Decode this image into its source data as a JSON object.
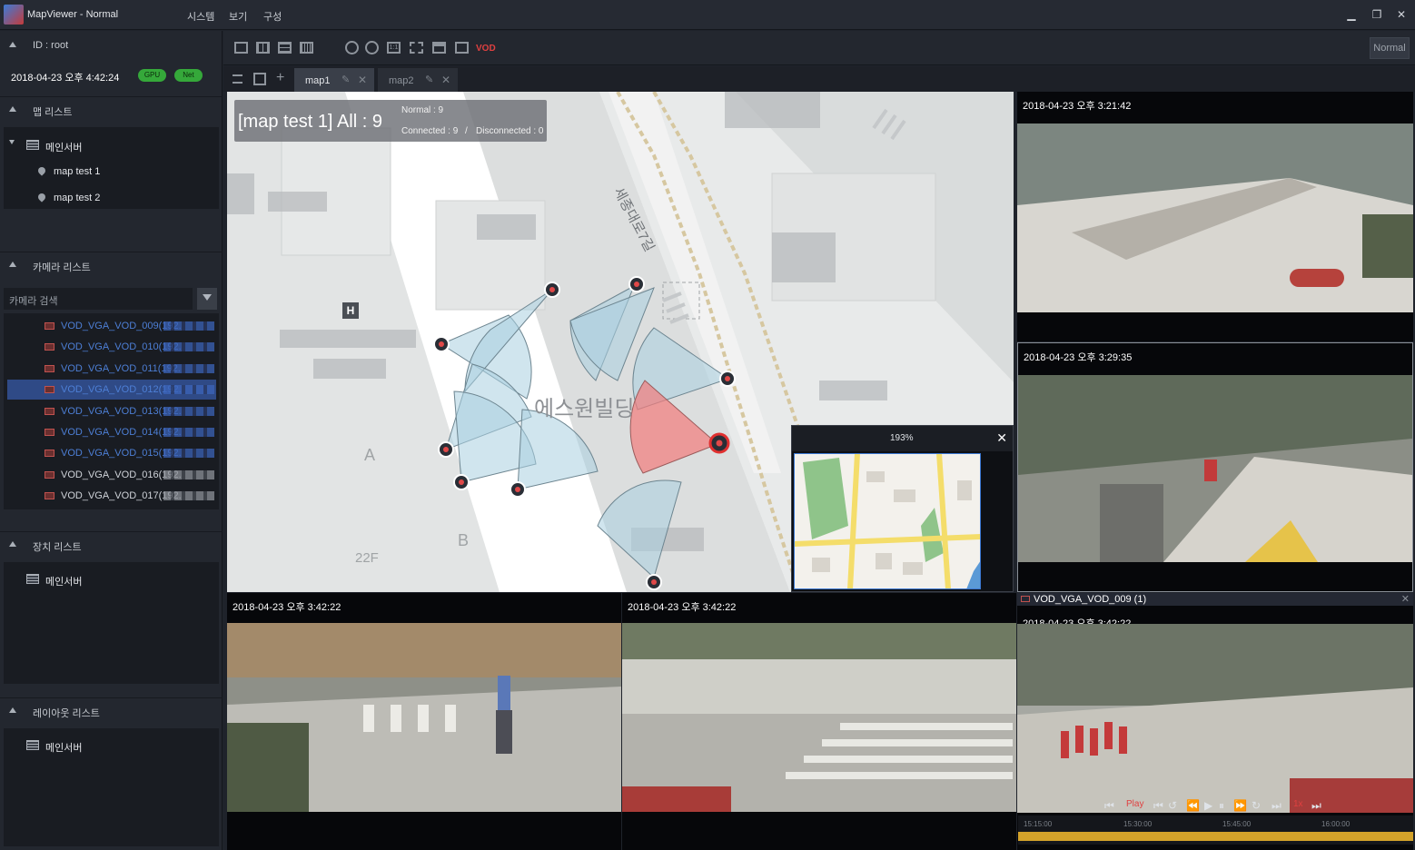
{
  "app": {
    "title": "MapViewer - Normal",
    "menu": [
      "시스템",
      "보기",
      "구성"
    ],
    "window_buttons": [
      "minimize",
      "restore",
      "close"
    ]
  },
  "sidebar": {
    "user": "ID : root",
    "datetime": "2018-04-23 오후 4:42:24",
    "badges": [
      {
        "label": "GPU",
        "color": "#35a83a"
      },
      {
        "label": "Net",
        "color": "#35a83a"
      }
    ],
    "map_list": {
      "title": "맵 리스트",
      "server": "메인서버",
      "maps": [
        "map test 1",
        "map test 2"
      ]
    },
    "camera_list": {
      "title": "카메라 리스트",
      "search_placeholder": "카메라 검색",
      "cameras": [
        {
          "label": "VOD_VGA_VOD_009(192.",
          "selected": false,
          "active": true
        },
        {
          "label": "VOD_VGA_VOD_010(192.",
          "selected": false,
          "active": true
        },
        {
          "label": "VOD_VGA_VOD_011(192.",
          "selected": false,
          "active": true
        },
        {
          "label": "VOD_VGA_VOD_012(192.",
          "selected": true,
          "active": true
        },
        {
          "label": "VOD_VGA_VOD_013(192.",
          "selected": false,
          "active": true
        },
        {
          "label": "VOD_VGA_VOD_014(192.",
          "selected": false,
          "active": true
        },
        {
          "label": "VOD_VGA_VOD_015(192.",
          "selected": false,
          "active": true
        },
        {
          "label": "VOD_VGA_VOD_016(192.",
          "selected": false,
          "active": false
        },
        {
          "label": "VOD_VGA_VOD_017(192.",
          "selected": false,
          "active": false
        }
      ]
    },
    "device_list": {
      "title": "장치 리스트",
      "server": "메인서버"
    },
    "layout_list": {
      "title": "레이아웃 리스트",
      "server": "메인서버"
    }
  },
  "toolbar": {
    "vod_label": "VOD",
    "mode_button": "Normal",
    "icons": [
      "layout-1x1-icon",
      "layout-2x2-icon",
      "layout-3x3-icon",
      "layout-4x4-icon",
      "zoom-in-icon",
      "zoom-out-icon",
      "actual-size-icon",
      "fit-icon",
      "window-icon",
      "export-icon"
    ]
  },
  "tabs": [
    {
      "label": "map1",
      "active": true
    },
    {
      "label": "map2",
      "active": false
    }
  ],
  "map": {
    "title": "[map test 1]",
    "all": "All : 9",
    "normal": "Normal : 9",
    "connected": "Connected : 9",
    "separator": "/",
    "disconnected": "Disconnected : 0",
    "building_label": "에스원빌딩",
    "street_label": "세종대로7길",
    "marker_a": "A",
    "marker_b": "B",
    "marker_h": "H",
    "floor_label": "22F"
  },
  "minimap": {
    "zoom": "193%"
  },
  "videos": [
    {
      "id": "top-right-1",
      "timestamp": "2018-04-23 오후 3:21:42"
    },
    {
      "id": "top-right-2",
      "timestamp": "2018-04-23 오후 3:29:35"
    },
    {
      "id": "bottom-1",
      "timestamp": "2018-04-23 오후 3:42:22"
    },
    {
      "id": "bottom-2",
      "timestamp": "2018-04-23 오후 3:42:22"
    },
    {
      "id": "bottom-3",
      "timestamp": "2018-04-23 오후 3:42:22",
      "camera_name": "VOD_VGA_VOD_009 (1)"
    }
  ],
  "playback": {
    "speed_label": "1x",
    "play_label": "Play",
    "timeline_ticks": [
      "15:15:00",
      "15:30:00",
      "15:45:00",
      "16:00:00"
    ]
  },
  "colors": {
    "fov_normal": "#a9cfe0",
    "fov_alert": "#f27c7c",
    "badge_green": "#35a83a",
    "selection_blue": "#2f4a86",
    "timeline_gold": "#d3a22a"
  }
}
